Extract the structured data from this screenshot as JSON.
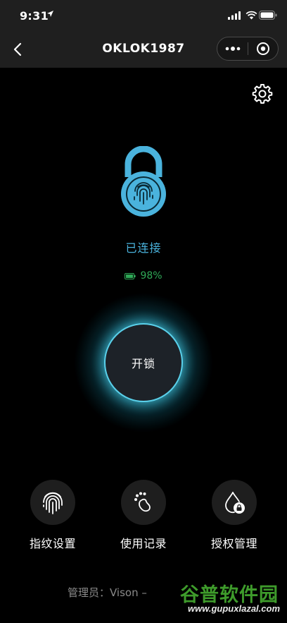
{
  "status_bar": {
    "time": "9:31"
  },
  "nav": {
    "title": "OKLOK1987"
  },
  "lock": {
    "connection_status": "已连接",
    "battery": "98%"
  },
  "unlock_button": {
    "label": "开锁"
  },
  "functions": [
    {
      "label": "指纹设置",
      "icon": "fingerprint-icon"
    },
    {
      "label": "使用记录",
      "icon": "footprint-icon"
    },
    {
      "label": "授权管理",
      "icon": "drop-lock-icon"
    }
  ],
  "footer": {
    "admin_text": "管理员：Vison –"
  },
  "watermark": {
    "title": "谷普软件园",
    "url": "www.gupuxlazal.com"
  },
  "colors": {
    "accent": "#4ab3dd",
    "battery_green": "#2fa957",
    "glow": "#5ad0ea"
  }
}
